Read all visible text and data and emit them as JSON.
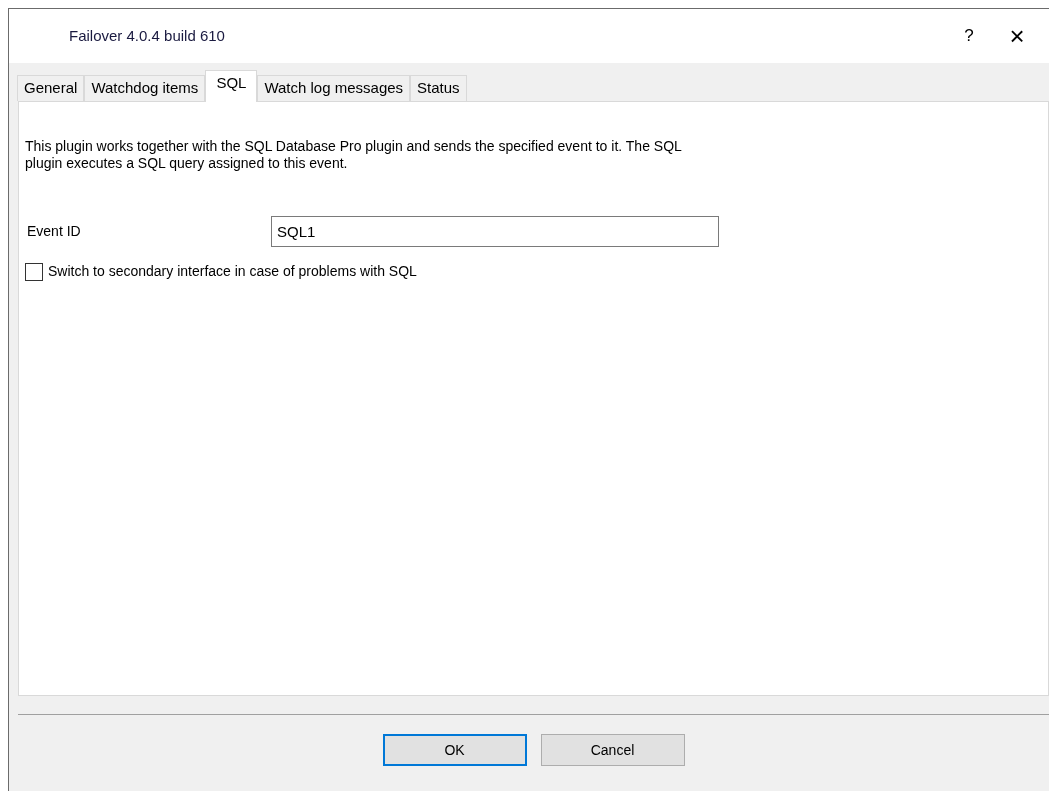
{
  "window": {
    "title": "Failover 4.0.4 build 610",
    "help": "?",
    "close": "×"
  },
  "tabs": [
    {
      "label": "General",
      "selected": false
    },
    {
      "label": "Watchdog items",
      "selected": false
    },
    {
      "label": "SQL",
      "selected": true
    },
    {
      "label": "Watch log messages",
      "selected": false
    },
    {
      "label": "Status",
      "selected": false
    }
  ],
  "description": "This plugin works together with the SQL Database Pro plugin and sends the specified event to it. The SQL plugin executes a SQL query assigned to this event.",
  "event_id": {
    "label": "Event ID",
    "value": "SQL1"
  },
  "switch_option": {
    "label": "Switch to secondary interface in case of problems with SQL",
    "checked": false
  },
  "buttons": [
    {
      "label": "OK",
      "default": true
    },
    {
      "label": "Cancel",
      "default": false
    }
  ]
}
